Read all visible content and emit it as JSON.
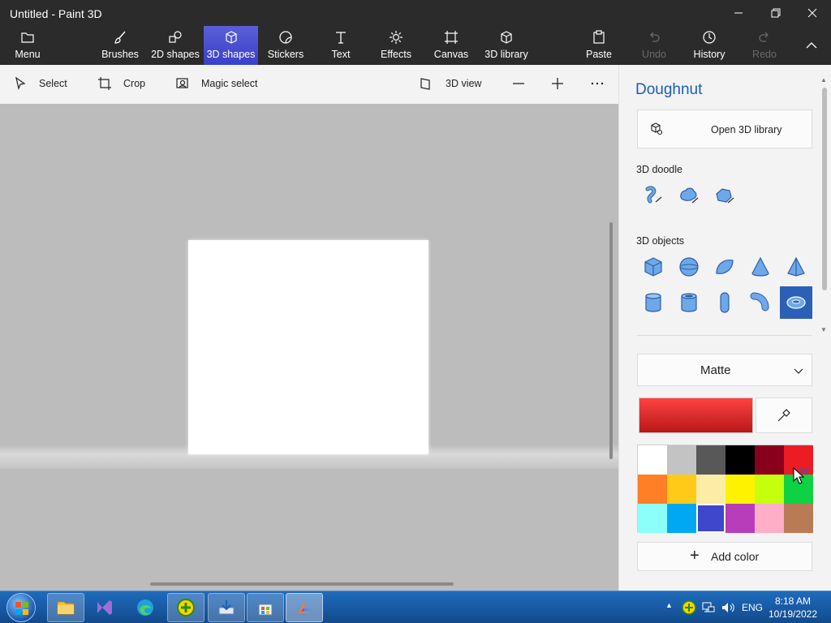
{
  "window": {
    "title": "Untitled - Paint 3D"
  },
  "ribbon": {
    "menu": "Menu",
    "tabs": [
      {
        "label": "Brushes"
      },
      {
        "label": "2D shapes"
      },
      {
        "label": "3D shapes"
      },
      {
        "label": "Stickers"
      },
      {
        "label": "Text"
      },
      {
        "label": "Effects"
      },
      {
        "label": "Canvas"
      },
      {
        "label": "3D library"
      }
    ],
    "active_tab": "3D shapes",
    "paste": "Paste",
    "undo": "Undo",
    "history": "History",
    "redo": "Redo"
  },
  "toolbar": {
    "select": "Select",
    "crop": "Crop",
    "magic_select": "Magic select",
    "view_3d": "3D view"
  },
  "panel": {
    "title": "Doughnut",
    "open_library": "Open 3D library",
    "doodle_label": "3D doodle",
    "objects_label": "3D objects",
    "material": "Matte",
    "add_color": "Add color",
    "selected_object": "doughnut"
  },
  "colors": {
    "accent": "#3a40c8",
    "current_color": "#e02020",
    "palette": [
      "#ffffff",
      "#c3c3c3",
      "#585858",
      "#000000",
      "#88001b",
      "#ec1c24",
      "#ff7f27",
      "#ffca18",
      "#fdeca6",
      "#fff200",
      "#c4ff0e",
      "#0ed145",
      "#8cfffb",
      "#00a8f3",
      "#3f48cc",
      "#b83dba",
      "#ffaec8",
      "#b97a56"
    ],
    "selected_swatch": 14
  },
  "taskbar": {
    "language": "ENG",
    "time": "8:18 AM",
    "date": "10/19/2022"
  }
}
